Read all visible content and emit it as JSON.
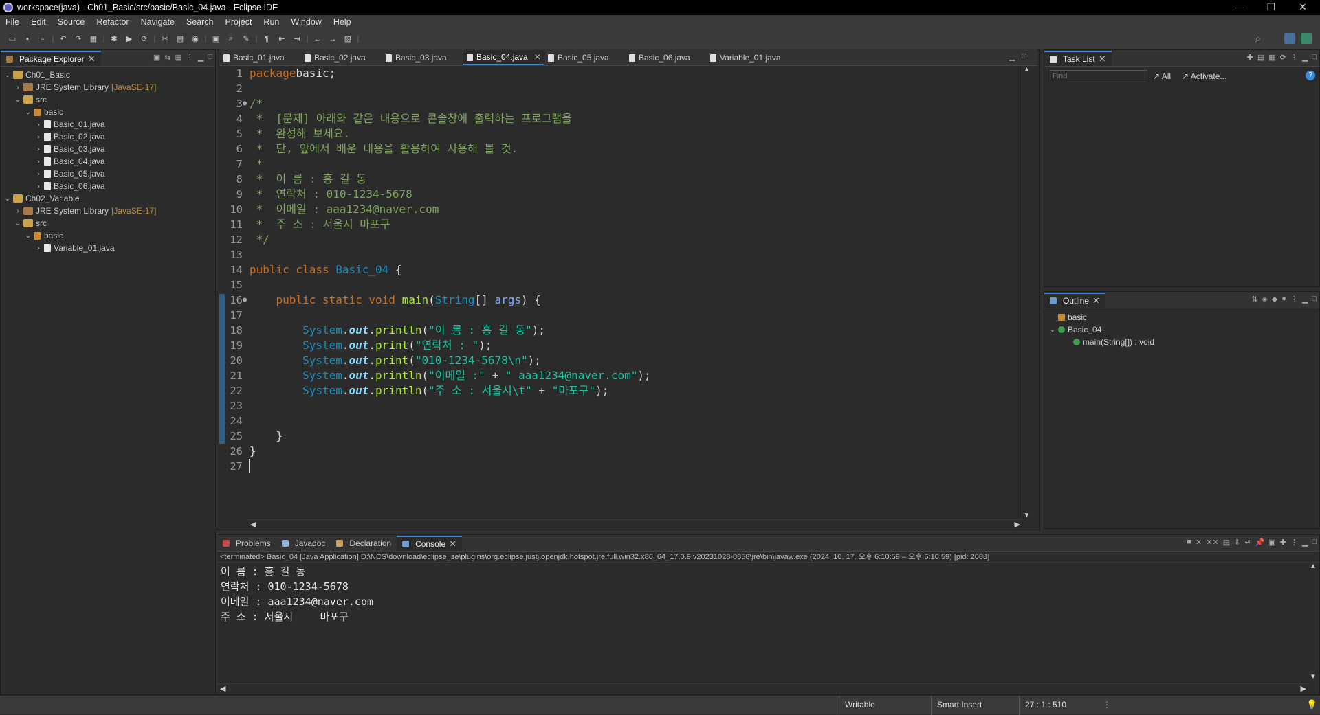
{
  "window": {
    "title": "workspace(java) - Ch01_Basic/src/basic/Basic_04.java - Eclipse IDE",
    "minimize": "—",
    "restore": "❐",
    "close": "✕"
  },
  "menu": [
    "File",
    "Edit",
    "Source",
    "Refactor",
    "Navigate",
    "Search",
    "Project",
    "Run",
    "Window",
    "Help"
  ],
  "toolbar": [
    "new",
    "save",
    "save-all",
    "undo",
    "redo",
    "build",
    "debug",
    "run",
    "run-ext",
    "ext-tools",
    "new-pkg",
    "new-class",
    "open-type",
    "search",
    "toggle-mark",
    "pin",
    "prev-edit",
    "next-edit",
    "back",
    "forward",
    "perspective"
  ],
  "package_explorer": {
    "tab_label": "Package Explorer",
    "tree": [
      {
        "label": "Ch01_Basic",
        "type": "proj",
        "level": 0,
        "tw": "⌄"
      },
      {
        "label": "JRE System Library",
        "suffix": "[JavaSE-17]",
        "type": "lib",
        "level": 1,
        "tw": "›"
      },
      {
        "label": "src",
        "type": "src",
        "level": 1,
        "tw": "⌄"
      },
      {
        "label": "basic",
        "type": "pkg",
        "level": 2,
        "tw": "⌄"
      },
      {
        "label": "Basic_01.java",
        "type": "jfile",
        "level": 3,
        "tw": "›"
      },
      {
        "label": "Basic_02.java",
        "type": "jfile",
        "level": 3,
        "tw": "›"
      },
      {
        "label": "Basic_03.java",
        "type": "jfile",
        "level": 3,
        "tw": "›"
      },
      {
        "label": "Basic_04.java",
        "type": "jfile",
        "level": 3,
        "tw": "›"
      },
      {
        "label": "Basic_05.java",
        "type": "jfile",
        "level": 3,
        "tw": "›"
      },
      {
        "label": "Basic_06.java",
        "type": "jfile",
        "level": 3,
        "tw": "›"
      },
      {
        "label": "Ch02_Variable",
        "type": "proj",
        "level": 0,
        "tw": "⌄"
      },
      {
        "label": "JRE System Library",
        "suffix": "[JavaSE-17]",
        "type": "lib",
        "level": 1,
        "tw": "›"
      },
      {
        "label": "src",
        "type": "src",
        "level": 1,
        "tw": "⌄"
      },
      {
        "label": "basic",
        "type": "pkg",
        "level": 2,
        "tw": "⌄"
      },
      {
        "label": "Variable_01.java",
        "type": "jfile",
        "level": 3,
        "tw": "›"
      }
    ]
  },
  "editor": {
    "tabs": [
      "Basic_01.java",
      "Basic_02.java",
      "Basic_03.java",
      "Basic_04.java",
      "Basic_05.java",
      "Basic_06.java",
      "Variable_01.java"
    ],
    "active_tab": 3,
    "lines": [
      [
        [
          "kw",
          "package"
        ],
        [
          "",
          "basic;"
        ]
      ],
      [],
      [
        [
          "cm",
          "/*"
        ]
      ],
      [
        [
          "cm",
          " *  [문제] 아래와 같은 내용으로 콘솔창에 출력하는 프로그램을"
        ]
      ],
      [
        [
          "cm",
          " *  완성해 보세요."
        ]
      ],
      [
        [
          "cm",
          " *  단, 앞에서 배운 내용을 활용하여 사용해 볼 것."
        ]
      ],
      [
        [
          "cm",
          " *"
        ]
      ],
      [
        [
          "cm",
          " *  이 름 : 홍 길 동"
        ]
      ],
      [
        [
          "cm",
          " *  연락처 : 010-1234-5678"
        ]
      ],
      [
        [
          "cm",
          " *  이메일 : aaa1234@naver.com"
        ]
      ],
      [
        [
          "cm",
          " *  주 소 : 서울시 마포구"
        ]
      ],
      [
        [
          "cm",
          " */"
        ]
      ],
      [],
      [
        [
          "kw",
          "public class "
        ],
        [
          "cls",
          "Basic_04"
        ],
        [
          "",
          " {"
        ]
      ],
      [],
      [
        [
          "",
          "    "
        ],
        [
          "kw",
          "public static void "
        ],
        [
          "mth",
          "main"
        ],
        [
          "",
          "("
        ],
        [
          "cls",
          "String"
        ],
        [
          "",
          "[] "
        ],
        [
          "var",
          "args"
        ],
        [
          "",
          ") {"
        ]
      ],
      [],
      [
        [
          "",
          "        "
        ],
        [
          "cls",
          "System"
        ],
        [
          "",
          "."
        ],
        [
          "fld",
          "out"
        ],
        [
          "",
          "."
        ],
        [
          "mth",
          "println"
        ],
        [
          "",
          "("
        ],
        [
          "str",
          "\"이 름 : 홍 길 동\""
        ],
        [
          "",
          ");"
        ]
      ],
      [
        [
          "",
          "        "
        ],
        [
          "cls",
          "System"
        ],
        [
          "",
          "."
        ],
        [
          "fld",
          "out"
        ],
        [
          "",
          "."
        ],
        [
          "mth",
          "print"
        ],
        [
          "",
          "("
        ],
        [
          "str",
          "\"연락처 : \""
        ],
        [
          "",
          ");"
        ]
      ],
      [
        [
          "",
          "        "
        ],
        [
          "cls",
          "System"
        ],
        [
          "",
          "."
        ],
        [
          "fld",
          "out"
        ],
        [
          "",
          "."
        ],
        [
          "mth",
          "print"
        ],
        [
          "",
          "("
        ],
        [
          "str",
          "\"010-1234-5678\\n\""
        ],
        [
          "",
          ");"
        ]
      ],
      [
        [
          "",
          "        "
        ],
        [
          "cls",
          "System"
        ],
        [
          "",
          "."
        ],
        [
          "fld",
          "out"
        ],
        [
          "",
          "."
        ],
        [
          "mth",
          "println"
        ],
        [
          "",
          "("
        ],
        [
          "str",
          "\"이메일 :\""
        ],
        [
          "",
          " + "
        ],
        [
          "str",
          "\" aaa1234@naver.com\""
        ],
        [
          "",
          ");"
        ]
      ],
      [
        [
          "",
          "        "
        ],
        [
          "cls",
          "System"
        ],
        [
          "",
          "."
        ],
        [
          "fld",
          "out"
        ],
        [
          "",
          "."
        ],
        [
          "mth",
          "println"
        ],
        [
          "",
          "("
        ],
        [
          "str",
          "\"주 소 : 서울시\\t\""
        ],
        [
          "",
          " + "
        ],
        [
          "str",
          "\"마포구\""
        ],
        [
          "",
          ");"
        ]
      ],
      [],
      [],
      [
        [
          "",
          "    }"
        ]
      ],
      [
        [
          "",
          "}"
        ]
      ],
      []
    ]
  },
  "task_list": {
    "tab_label": "Task List",
    "find_placeholder": "Find",
    "all_label": "All",
    "activate_label": "Activate..."
  },
  "outline": {
    "tab_label": "Outline",
    "items": [
      {
        "label": "basic",
        "level": 0,
        "tw": ""
      },
      {
        "label": "Basic_04",
        "level": 0,
        "tw": "⌄"
      },
      {
        "label": "main(String[]) : void",
        "level": 1,
        "tw": ""
      }
    ]
  },
  "bottom_tabs": [
    "Problems",
    "Javadoc",
    "Declaration",
    "Console"
  ],
  "bottom_active": 3,
  "console": {
    "header": "<terminated> Basic_04 [Java Application] D:\\NCS\\download\\eclipse_se\\plugins\\org.eclipse.justj.openjdk.hotspot.jre.full.win32.x86_64_17.0.9.v20231028-0858\\jre\\bin\\javaw.exe  (2024. 10. 17. 오후 6:10:59 – 오후 6:10:59) [pid: 2088]",
    "output": [
      "이 름 : 홍 길 동",
      "연락처 : 010-1234-5678",
      "이메일 : aaa1234@naver.com",
      "주 소 : 서울시\t마포구"
    ]
  },
  "status": {
    "writable": "Writable",
    "insert_mode": "Smart Insert",
    "position": "27 : 1 : 510"
  },
  "colors": {
    "accent": "#3b8bd8",
    "background": "#2b2b2b"
  }
}
